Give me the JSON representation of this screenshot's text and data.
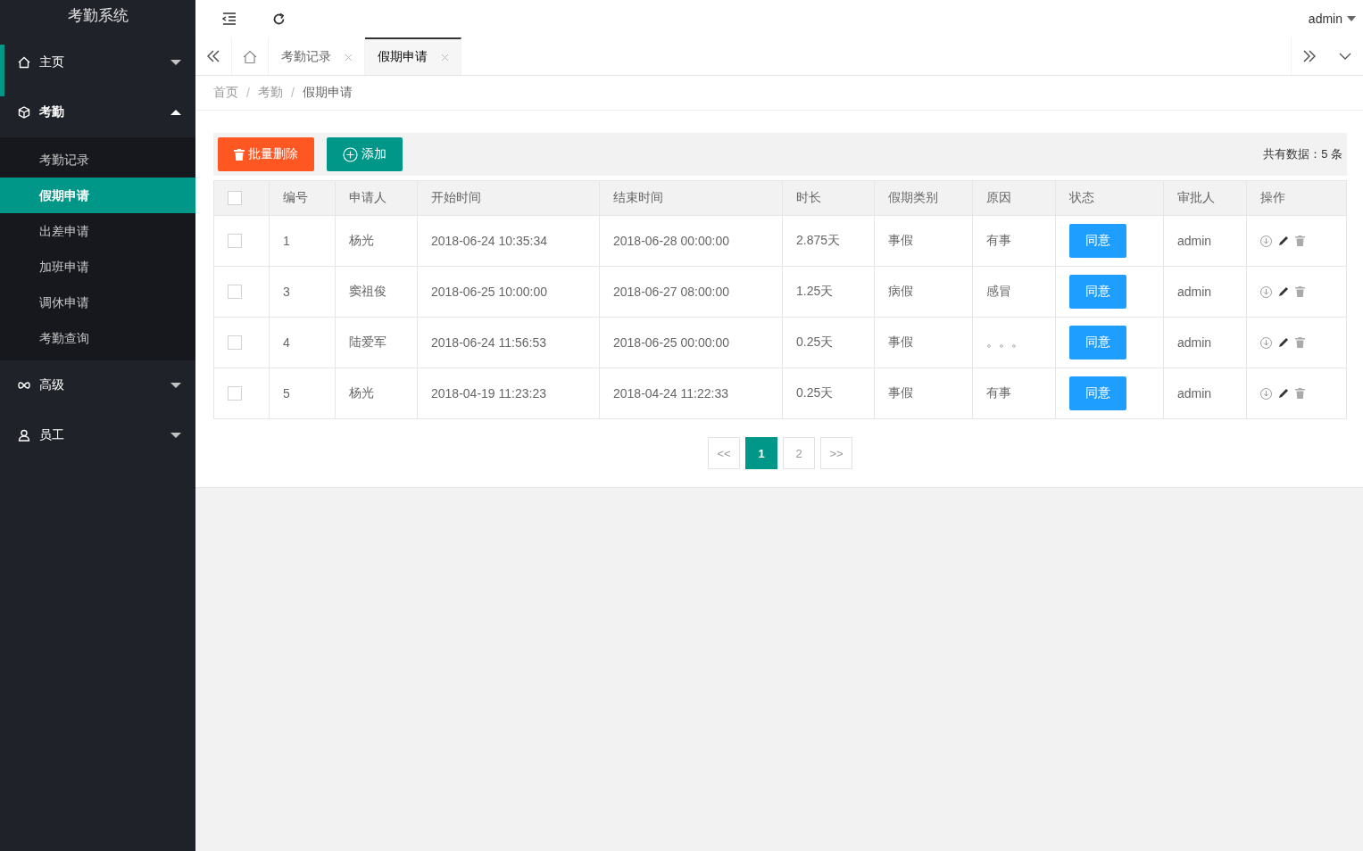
{
  "sidebar": {
    "title": "考勤系统",
    "menu": [
      {
        "label": "主页",
        "current": true,
        "expanded": false
      },
      {
        "label": "考勤",
        "current": false,
        "expanded": true,
        "children": [
          {
            "label": "考勤记录",
            "selected": false
          },
          {
            "label": "假期申请",
            "selected": true
          },
          {
            "label": "出差申请",
            "selected": false
          },
          {
            "label": "加班申请",
            "selected": false
          },
          {
            "label": "调休申请",
            "selected": false
          },
          {
            "label": "考勤查询",
            "selected": false
          }
        ]
      },
      {
        "label": "高级",
        "current": false,
        "expanded": false
      },
      {
        "label": "员工",
        "current": false,
        "expanded": false
      }
    ]
  },
  "header": {
    "user": "admin"
  },
  "tabs": [
    {
      "label": "考勤记录",
      "selected": false
    },
    {
      "label": "假期申请",
      "selected": true
    }
  ],
  "breadcrumb": {
    "separator": "/",
    "items": [
      "首页",
      "考勤",
      "假期申请"
    ]
  },
  "toolbar": {
    "buttons": [
      {
        "kind": "danger",
        "label": "批量删除"
      },
      {
        "kind": "primary",
        "label": "添加"
      }
    ],
    "total": "共有数据：5 条"
  },
  "table": {
    "all_checked": false,
    "columns": [
      "编号",
      "申请人",
      "开始时间",
      "结束时间",
      "时长",
      "假期类别",
      "原因",
      "状态",
      "审批人",
      "操作"
    ],
    "rows": [
      {
        "checked": false,
        "cells": [
          "1",
          "杨光",
          "2018-06-24 10:35:34",
          "2018-06-28 00:00:00",
          "2.875天",
          "事假",
          "有事"
        ],
        "status": "同意",
        "approver": "admin"
      },
      {
        "checked": false,
        "cells": [
          "3",
          "窦祖俊",
          "2018-06-25 10:00:00",
          "2018-06-27 08:00:00",
          "1.25天",
          "病假",
          "感冒"
        ],
        "status": "同意",
        "approver": "admin"
      },
      {
        "checked": false,
        "cells": [
          "4",
          "陆爱军",
          "2018-06-24 11:56:53",
          "2018-06-25 00:00:00",
          "0.25天",
          "事假",
          "。。。"
        ],
        "status": "同意",
        "approver": "admin"
      },
      {
        "checked": false,
        "cells": [
          "5",
          "杨光",
          "2018-04-19 11:23:23",
          "2018-04-24 11:22:33",
          "0.25天",
          "事假",
          "有事"
        ],
        "status": "同意",
        "approver": "admin"
      }
    ]
  },
  "pagination": [
    {
      "label": "<<",
      "selected": false
    },
    {
      "label": "1",
      "selected": true
    },
    {
      "label": "2",
      "selected": false
    },
    {
      "label": ">>",
      "selected": false
    }
  ]
}
